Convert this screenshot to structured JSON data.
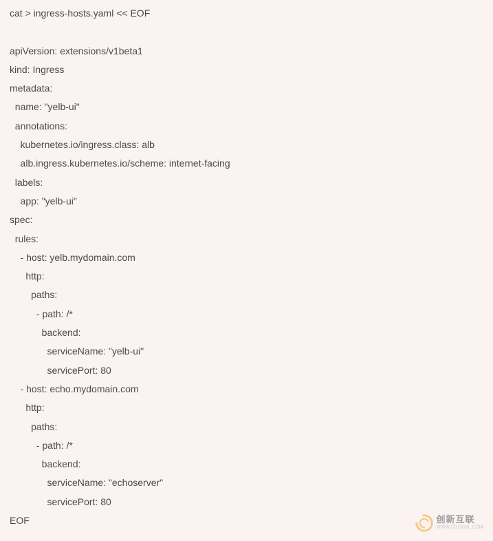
{
  "code": {
    "lines": [
      "cat > ingress-hosts.yaml << EOF",
      "",
      "apiVersion: extensions/v1beta1",
      "kind: Ingress",
      "metadata:",
      "  name: \"yelb-ui\"",
      "  annotations:",
      "    kubernetes.io/ingress.class: alb",
      "    alb.ingress.kubernetes.io/scheme: internet-facing",
      "  labels:",
      "    app: \"yelb-ui\"",
      "spec:",
      "  rules:",
      "    - host: yelb.mydomain.com",
      "      http:",
      "        paths:",
      "          - path: /*",
      "            backend:",
      "              serviceName: \"yelb-ui\"",
      "              servicePort: 80",
      "    - host: echo.mydomain.com",
      "      http:",
      "        paths:",
      "          - path: /*",
      "            backend:",
      "              serviceName: \"echoserver\"",
      "              servicePort: 80",
      "EOF"
    ]
  },
  "watermark": {
    "main": "创新互联",
    "sub": "WWW.CDCXHL.COM"
  }
}
